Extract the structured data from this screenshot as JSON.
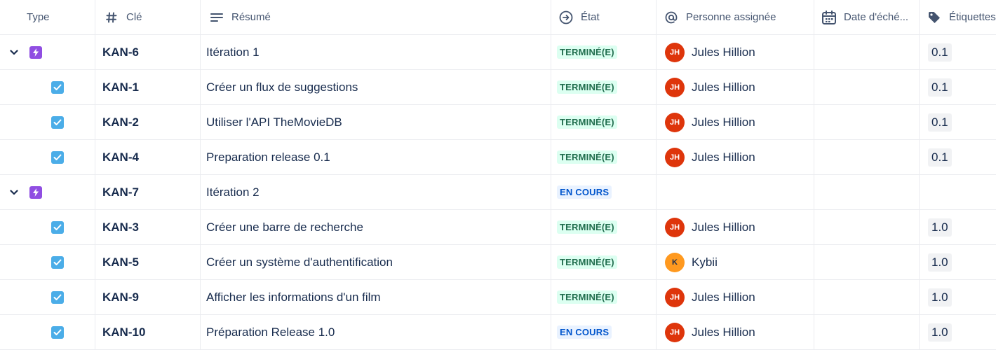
{
  "columns": {
    "type": "Type",
    "key": "Clé",
    "summary": "Résumé",
    "state": "État",
    "assignee": "Personne assignée",
    "due_date": "Date d'éché...",
    "labels": "Étiquettes"
  },
  "icons": {
    "epic": "epic-lightning-icon",
    "task": "task-checkbox-icon",
    "expand": "chevron-down-icon"
  },
  "colors": {
    "epic": "#904ee2",
    "task": "#4bade8",
    "done_bg": "#dcfff1",
    "done_fg": "#216e4e",
    "progress_bg": "#e9f2ff",
    "progress_fg": "#0055cc"
  },
  "rows": [
    {
      "type": "epic",
      "key": "KAN-6",
      "summary": "Itération 1",
      "status": "TERMINÉ(E)",
      "status_kind": "done",
      "assignee_initials": "JH",
      "assignee": "Jules Hillion",
      "due_date": "",
      "label": "0.1"
    },
    {
      "type": "task",
      "key": "KAN-1",
      "summary": "Créer un flux de suggestions",
      "status": "TERMINÉ(E)",
      "status_kind": "done",
      "assignee_initials": "JH",
      "assignee": "Jules Hillion",
      "due_date": "",
      "label": "0.1"
    },
    {
      "type": "task",
      "key": "KAN-2",
      "summary": "Utiliser l'API TheMovieDB",
      "status": "TERMINÉ(E)",
      "status_kind": "done",
      "assignee_initials": "JH",
      "assignee": "Jules Hillion",
      "due_date": "",
      "label": "0.1"
    },
    {
      "type": "task",
      "key": "KAN-4",
      "summary": "Preparation release 0.1",
      "status": "TERMINÉ(E)",
      "status_kind": "done",
      "assignee_initials": "JH",
      "assignee": "Jules Hillion",
      "due_date": "",
      "label": "0.1"
    },
    {
      "type": "epic",
      "key": "KAN-7",
      "summary": "Itération 2",
      "status": "EN COURS",
      "status_kind": "progress",
      "assignee_initials": "",
      "assignee": "",
      "due_date": "",
      "label": ""
    },
    {
      "type": "task",
      "key": "KAN-3",
      "summary": "Créer une barre de recherche",
      "status": "TERMINÉ(E)",
      "status_kind": "done",
      "assignee_initials": "JH",
      "assignee": "Jules Hillion",
      "due_date": "",
      "label": "1.0"
    },
    {
      "type": "task",
      "key": "KAN-5",
      "summary": "Créer un système d'authentification",
      "status": "TERMINÉ(E)",
      "status_kind": "done",
      "assignee_initials": "K",
      "assignee": "Kybii",
      "due_date": "",
      "label": "1.0"
    },
    {
      "type": "task",
      "key": "KAN-9",
      "summary": "Afficher les informations d'un film",
      "status": "TERMINÉ(E)",
      "status_kind": "done",
      "assignee_initials": "JH",
      "assignee": "Jules Hillion",
      "due_date": "",
      "label": "1.0"
    },
    {
      "type": "task",
      "key": "KAN-10",
      "summary": "Préparation Release 1.0",
      "status": "EN COURS",
      "status_kind": "progress",
      "assignee_initials": "JH",
      "assignee": "Jules Hillion",
      "due_date": "",
      "label": "1.0"
    }
  ]
}
